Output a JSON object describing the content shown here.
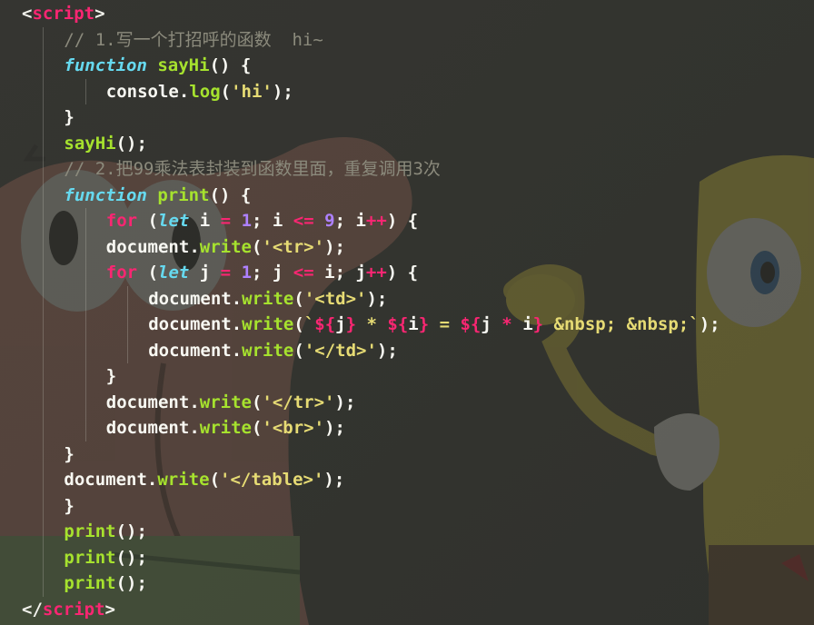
{
  "editor": {
    "theme_colors": {
      "background": "#33342f",
      "tag_bracket": "#f2f2ec",
      "tag_name": "#f92672",
      "comment": "#8b8a7c",
      "keyword": "#66d9ef",
      "control": "#f92672",
      "function": "#a6e22e",
      "string": "#e6db74",
      "number": "#ae81ff",
      "text": "#f8f8f2"
    },
    "lines": [
      {
        "indent": 0,
        "guides": [],
        "tokens": [
          {
            "t": "<",
            "c": "tag"
          },
          {
            "t": "script",
            "c": "tagname"
          },
          {
            "t": ">",
            "c": "tag"
          }
        ]
      },
      {
        "indent": 2,
        "guides": [
          1
        ],
        "tokens": [
          {
            "t": "// 1.写一个打招呼的函数  hi~",
            "c": "cmt"
          }
        ]
      },
      {
        "indent": 2,
        "guides": [
          1
        ],
        "tokens": [
          {
            "t": "function",
            "c": "kw-it"
          },
          {
            "t": " ",
            "c": "plain"
          },
          {
            "t": "sayHi",
            "c": "fn"
          },
          {
            "t": "() {",
            "c": "plain"
          }
        ]
      },
      {
        "indent": 4,
        "guides": [
          1,
          3
        ],
        "tokens": [
          {
            "t": "console",
            "c": "plain"
          },
          {
            "t": ".",
            "c": "plain"
          },
          {
            "t": "log",
            "c": "fn"
          },
          {
            "t": "(",
            "c": "plain"
          },
          {
            "t": "'hi'",
            "c": "str"
          },
          {
            "t": ");",
            "c": "plain"
          }
        ]
      },
      {
        "indent": 2,
        "guides": [
          1
        ],
        "tokens": [
          {
            "t": "}",
            "c": "plain"
          }
        ]
      },
      {
        "indent": 2,
        "guides": [
          1
        ],
        "tokens": [
          {
            "t": "sayHi",
            "c": "fn"
          },
          {
            "t": "();",
            "c": "plain"
          }
        ]
      },
      {
        "indent": 2,
        "guides": [
          1
        ],
        "tokens": [
          {
            "t": "// 2.把99乘法表封装到函数里面，重复调用3次",
            "c": "cmt"
          }
        ]
      },
      {
        "indent": 2,
        "guides": [
          1
        ],
        "tokens": [
          {
            "t": "function",
            "c": "kw-it"
          },
          {
            "t": " ",
            "c": "plain"
          },
          {
            "t": "print",
            "c": "fn"
          },
          {
            "t": "() {",
            "c": "plain"
          }
        ]
      },
      {
        "indent": 4,
        "guides": [
          1,
          3
        ],
        "tokens": [
          {
            "t": "for",
            "c": "kw-red"
          },
          {
            "t": " (",
            "c": "plain"
          },
          {
            "t": "let",
            "c": "kw-it"
          },
          {
            "t": " i ",
            "c": "plain"
          },
          {
            "t": "=",
            "c": "op"
          },
          {
            "t": " ",
            "c": "plain"
          },
          {
            "t": "1",
            "c": "num"
          },
          {
            "t": "; i ",
            "c": "plain"
          },
          {
            "t": "<=",
            "c": "op"
          },
          {
            "t": " ",
            "c": "plain"
          },
          {
            "t": "9",
            "c": "num"
          },
          {
            "t": "; i",
            "c": "plain"
          },
          {
            "t": "++",
            "c": "op"
          },
          {
            "t": ") {",
            "c": "plain"
          }
        ]
      },
      {
        "indent": 4,
        "guides": [
          1,
          3
        ],
        "tokens": [
          {
            "t": "document",
            "c": "plain"
          },
          {
            "t": ".",
            "c": "plain"
          },
          {
            "t": "write",
            "c": "fn"
          },
          {
            "t": "(",
            "c": "plain"
          },
          {
            "t": "'<tr>'",
            "c": "str"
          },
          {
            "t": ");",
            "c": "plain"
          }
        ]
      },
      {
        "indent": 4,
        "guides": [
          1,
          3
        ],
        "tokens": [
          {
            "t": "for",
            "c": "kw-red"
          },
          {
            "t": " (",
            "c": "plain"
          },
          {
            "t": "let",
            "c": "kw-it"
          },
          {
            "t": " j ",
            "c": "plain"
          },
          {
            "t": "=",
            "c": "op"
          },
          {
            "t": " ",
            "c": "plain"
          },
          {
            "t": "1",
            "c": "num"
          },
          {
            "t": "; j ",
            "c": "plain"
          },
          {
            "t": "<=",
            "c": "op"
          },
          {
            "t": " i; j",
            "c": "plain"
          },
          {
            "t": "++",
            "c": "op"
          },
          {
            "t": ") {",
            "c": "plain"
          }
        ]
      },
      {
        "indent": 6,
        "guides": [
          1,
          3,
          5
        ],
        "tokens": [
          {
            "t": "document",
            "c": "plain"
          },
          {
            "t": ".",
            "c": "plain"
          },
          {
            "t": "write",
            "c": "fn"
          },
          {
            "t": "(",
            "c": "plain"
          },
          {
            "t": "'<td>'",
            "c": "str"
          },
          {
            "t": ");",
            "c": "plain"
          }
        ]
      },
      {
        "indent": 6,
        "guides": [
          1,
          3,
          5
        ],
        "tokens": [
          {
            "t": "document",
            "c": "plain"
          },
          {
            "t": ".",
            "c": "plain"
          },
          {
            "t": "write",
            "c": "fn"
          },
          {
            "t": "(",
            "c": "plain"
          },
          {
            "t": "`",
            "c": "str"
          },
          {
            "t": "${",
            "c": "tmpl"
          },
          {
            "t": "j",
            "c": "plain"
          },
          {
            "t": "}",
            "c": "tmpl"
          },
          {
            "t": " * ",
            "c": "str"
          },
          {
            "t": "${",
            "c": "tmpl"
          },
          {
            "t": "i",
            "c": "plain"
          },
          {
            "t": "}",
            "c": "tmpl"
          },
          {
            "t": " = ",
            "c": "str"
          },
          {
            "t": "${",
            "c": "tmpl"
          },
          {
            "t": "j ",
            "c": "plain"
          },
          {
            "t": "*",
            "c": "op"
          },
          {
            "t": " i",
            "c": "plain"
          },
          {
            "t": "}",
            "c": "tmpl"
          },
          {
            "t": " &nbsp; &nbsp;`",
            "c": "str"
          },
          {
            "t": ");",
            "c": "plain"
          }
        ]
      },
      {
        "indent": 6,
        "guides": [
          1,
          3,
          5
        ],
        "tokens": [
          {
            "t": "document",
            "c": "plain"
          },
          {
            "t": ".",
            "c": "plain"
          },
          {
            "t": "write",
            "c": "fn"
          },
          {
            "t": "(",
            "c": "plain"
          },
          {
            "t": "'</td>'",
            "c": "str"
          },
          {
            "t": ");",
            "c": "plain"
          }
        ]
      },
      {
        "indent": 4,
        "guides": [
          1,
          3
        ],
        "tokens": [
          {
            "t": "}",
            "c": "plain"
          }
        ]
      },
      {
        "indent": 4,
        "guides": [
          1,
          3
        ],
        "tokens": [
          {
            "t": "document",
            "c": "plain"
          },
          {
            "t": ".",
            "c": "plain"
          },
          {
            "t": "write",
            "c": "fn"
          },
          {
            "t": "(",
            "c": "plain"
          },
          {
            "t": "'</tr>'",
            "c": "str"
          },
          {
            "t": ");",
            "c": "plain"
          }
        ]
      },
      {
        "indent": 4,
        "guides": [
          1,
          3
        ],
        "tokens": [
          {
            "t": "document",
            "c": "plain"
          },
          {
            "t": ".",
            "c": "plain"
          },
          {
            "t": "write",
            "c": "fn"
          },
          {
            "t": "(",
            "c": "plain"
          },
          {
            "t": "'<br>'",
            "c": "str"
          },
          {
            "t": ");",
            "c": "plain"
          }
        ]
      },
      {
        "indent": 2,
        "guides": [
          1
        ],
        "tokens": [
          {
            "t": "}",
            "c": "plain"
          }
        ]
      },
      {
        "indent": 2,
        "guides": [
          1
        ],
        "tokens": [
          {
            "t": "document",
            "c": "plain"
          },
          {
            "t": ".",
            "c": "plain"
          },
          {
            "t": "write",
            "c": "fn"
          },
          {
            "t": "(",
            "c": "plain"
          },
          {
            "t": "'</table>'",
            "c": "str"
          },
          {
            "t": ");",
            "c": "plain"
          }
        ]
      },
      {
        "indent": 2,
        "guides": [
          1
        ],
        "tokens": [
          {
            "t": "}",
            "c": "plain"
          }
        ]
      },
      {
        "indent": 2,
        "guides": [
          1
        ],
        "tokens": [
          {
            "t": "print",
            "c": "fn"
          },
          {
            "t": "();",
            "c": "plain"
          }
        ]
      },
      {
        "indent": 2,
        "guides": [
          1
        ],
        "tokens": [
          {
            "t": "print",
            "c": "fn"
          },
          {
            "t": "();",
            "c": "plain"
          }
        ]
      },
      {
        "indent": 2,
        "guides": [
          1
        ],
        "tokens": [
          {
            "t": "print",
            "c": "fn"
          },
          {
            "t": "();",
            "c": "plain"
          }
        ]
      },
      {
        "indent": 0,
        "guides": [],
        "tokens": [
          {
            "t": "</",
            "c": "tag"
          },
          {
            "t": "script",
            "c": "tagname"
          },
          {
            "t": ">",
            "c": "tag"
          }
        ]
      }
    ]
  },
  "wallpaper": {
    "icons": [
      "patrick-star-icon",
      "spongebob-icon"
    ]
  }
}
